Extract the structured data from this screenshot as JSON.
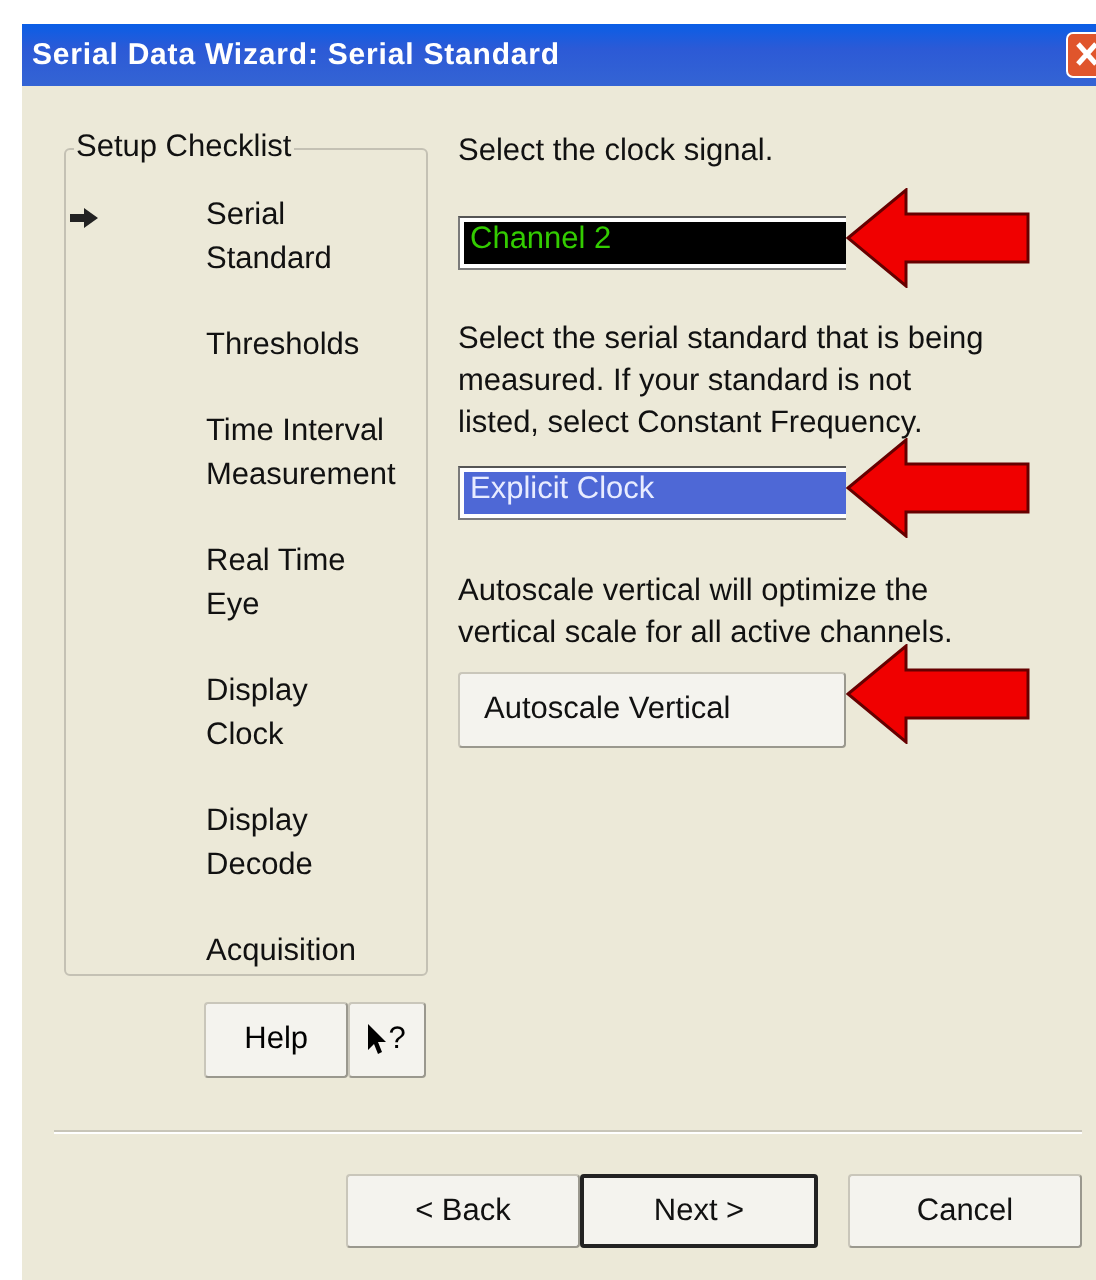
{
  "window": {
    "title": "Serial Data Wizard: Serial Standard"
  },
  "checklist": {
    "title": "Setup Checklist",
    "items": [
      {
        "label": "Serial\nStandard",
        "selected": true
      },
      {
        "label": "Thresholds",
        "selected": false
      },
      {
        "label": "Time Interval\nMeasurement",
        "selected": false
      },
      {
        "label": "Real Time\nEye",
        "selected": false
      },
      {
        "label": "Display\nClock",
        "selected": false
      },
      {
        "label": "Display\nDecode",
        "selected": false
      },
      {
        "label": "Acquisition",
        "selected": false
      }
    ]
  },
  "help_buttons": {
    "help": "Help",
    "whats_this": "?"
  },
  "steps": [
    {
      "kind": "dropdown",
      "prompt": "Select the clock signal.",
      "value": "Channel 2",
      "annotated": true
    },
    {
      "kind": "dropdown",
      "prompt": "Select the serial standard that is being measured. If your standard is not listed, select Constant Frequency.",
      "value": "Explicit Clock",
      "annotated": true
    },
    {
      "kind": "button",
      "prompt": "Autoscale vertical will optimize the vertical scale for all active channels.",
      "value": "Autoscale Vertical",
      "annotated": true
    }
  ],
  "nav_buttons": [
    {
      "label": "< Back",
      "default": false
    },
    {
      "label": "Next >",
      "default": true
    },
    {
      "label": "Cancel",
      "default": false
    }
  ]
}
